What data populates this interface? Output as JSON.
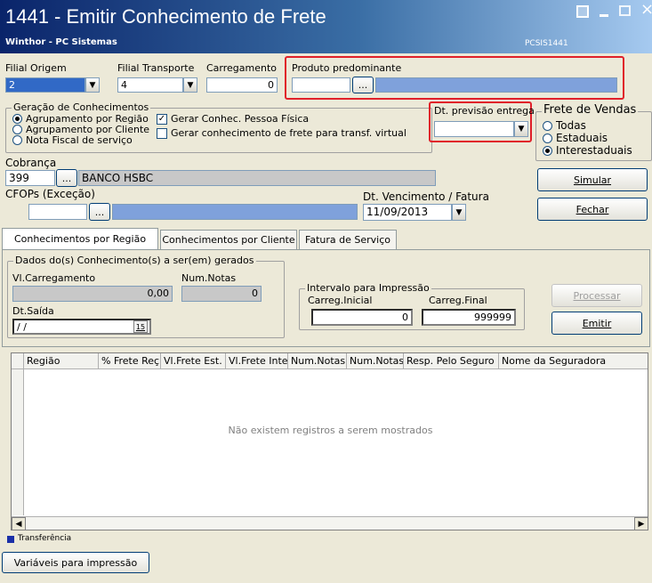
{
  "window": {
    "title": "1441 - Emitir Conhecimento de Frete",
    "subtitle": "Winthor - PC Sistemas",
    "code": "PCSIS1441",
    "colors": {
      "titlebar_start": "#0A246A",
      "titlebar_end": "#A6CAF0",
      "highlight": "#E0202A",
      "accent_blue": "#7FA1DB"
    }
  },
  "header": {
    "filial_origem_label": "Filial Origem",
    "filial_origem_value": "2",
    "filial_transporte_label": "Filial Transporte",
    "filial_transporte_value": "4",
    "carregamento_label": "Carregamento",
    "carregamento_value": "0",
    "produto_label": "Produto predominante",
    "produto_value": "",
    "browse": "..."
  },
  "geracao": {
    "title": "Geração de Conhecimentos",
    "radios": [
      {
        "label": "Agrupamento por Região",
        "selected": true
      },
      {
        "label": "Agrupamento por Cliente",
        "selected": false
      },
      {
        "label": "Nota Fiscal de serviço",
        "selected": false
      }
    ],
    "checkboxes": [
      {
        "label": "Gerar Conhec. Pessoa Física",
        "checked": true
      },
      {
        "label": "Gerar conhecimento de frete para transf. virtual",
        "checked": false
      }
    ]
  },
  "previsao": {
    "label": "Dt. previsão entrega",
    "value": ""
  },
  "frete_vendas": {
    "title": "Frete de Vendas",
    "options": [
      {
        "label": "Todas",
        "selected": false
      },
      {
        "label": "Estaduais",
        "selected": false
      },
      {
        "label": "Interestaduais",
        "selected": true
      }
    ]
  },
  "cobranca": {
    "label": "Cobrança",
    "code": "399",
    "name": "BANCO HSBC"
  },
  "cfops": {
    "label": "CFOPs (Exceção)",
    "value": ""
  },
  "vencimento": {
    "label": "Dt. Vencimento / Fatura",
    "value": "11/09/2013"
  },
  "buttons": {
    "simular": "Simular",
    "fechar": "Fechar",
    "processar": "Processar",
    "emitir": "Emitir",
    "variaveis": "Variáveis para impressão"
  },
  "tabs": [
    "Conhecimentos por Região",
    "Conhecimentos por Cliente",
    "Fatura de Serviço"
  ],
  "dados": {
    "title": "Dados do(s) Conhecimento(s) a ser(em) gerados",
    "vl_carregamento_label": "Vl.Carregamento",
    "vl_carregamento_value": "0,00",
    "num_notas_label": "Num.Notas",
    "num_notas_value": "0",
    "dt_saida_label": "Dt.Saída",
    "dt_saida_value": " / /",
    "calendar_glyph": "15"
  },
  "intervalo": {
    "title": "Intervalo para Impressão",
    "inicial_label": "Carreg.Inicial",
    "inicial_value": "0",
    "final_label": "Carreg.Final",
    "final_value": "999999"
  },
  "grid": {
    "columns": [
      "Região",
      "% Frete Reç",
      "Vl.Frete Est.",
      "Vl.Frete Inte",
      "Num.Notas E",
      "Num.Notas I",
      "Resp. Pelo Seguro",
      "Nome da Seguradora"
    ],
    "empty_message": "Não existem registros a serem mostrados"
  },
  "legend": {
    "label": "Transferência",
    "color": "#1A2FA8"
  }
}
